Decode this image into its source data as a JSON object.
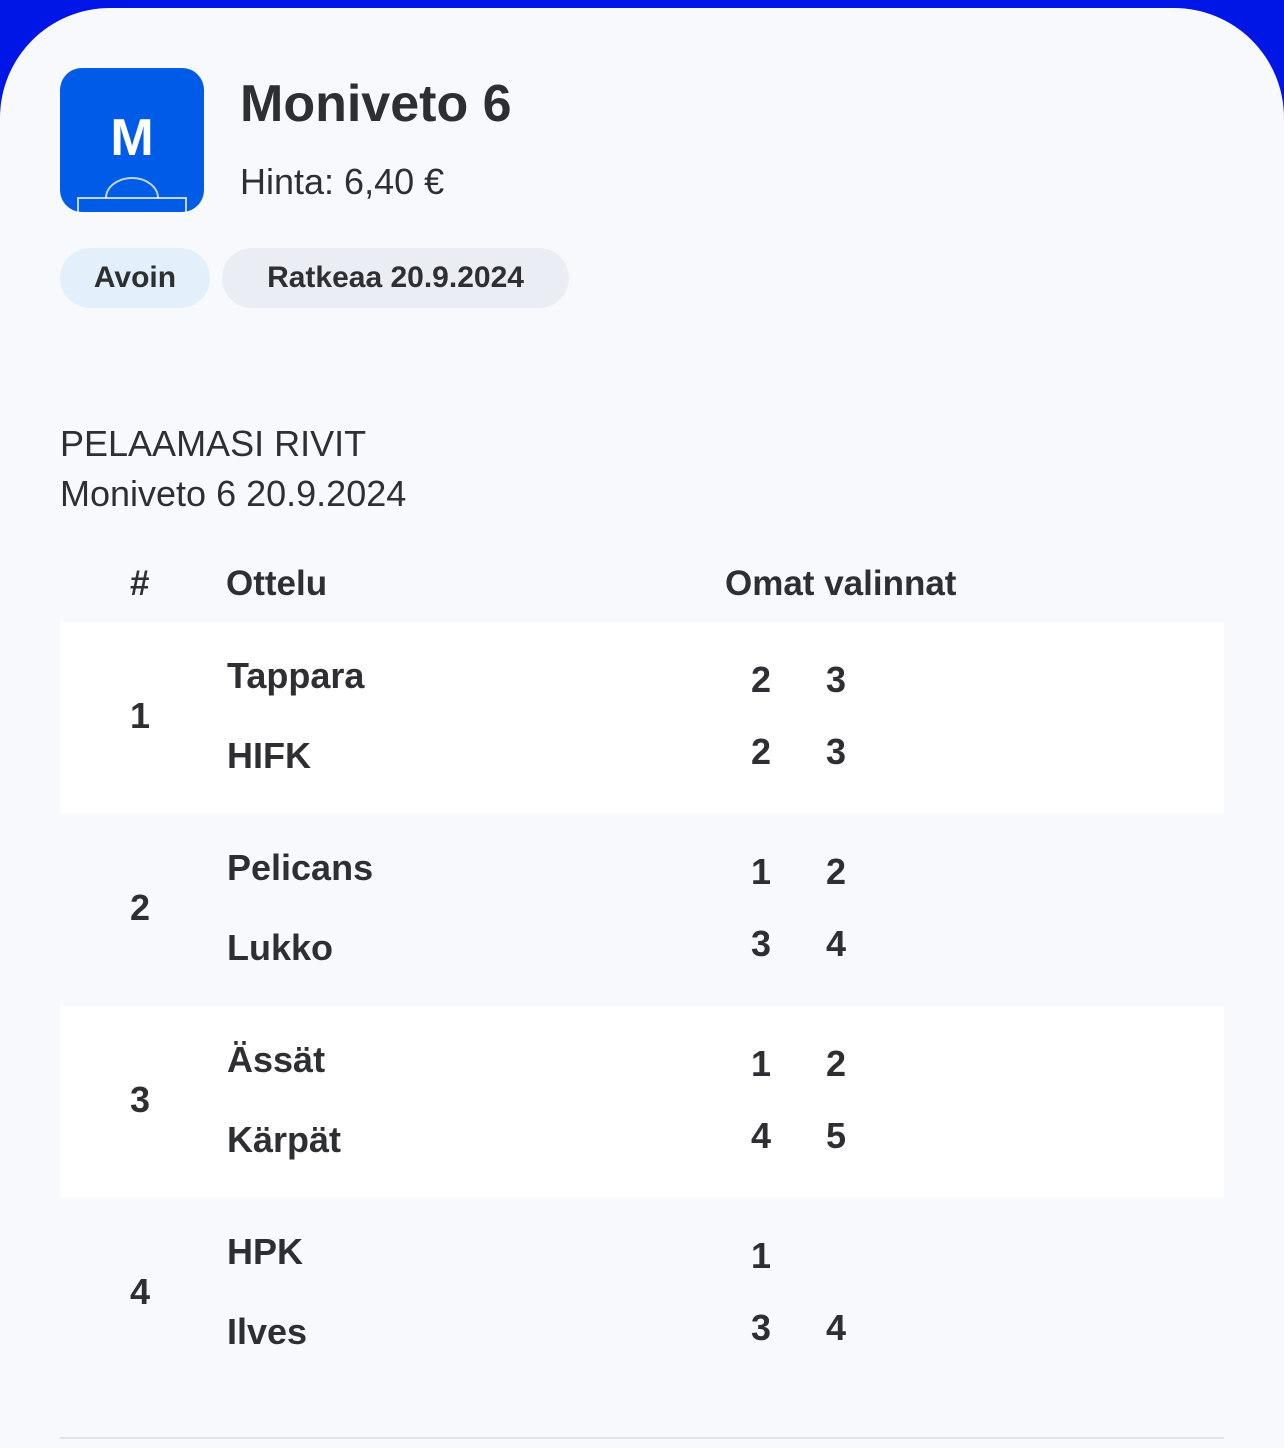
{
  "header": {
    "logo_letter": "M",
    "title": "Moniveto 6",
    "price": "Hinta: 6,40 €"
  },
  "chips": {
    "status": "Avoin",
    "resolves": "Ratkeaa 20.9.2024"
  },
  "section": {
    "heading": "PELAAMASI RIVIT",
    "subheading": "Moniveto 6 20.9.2024"
  },
  "table": {
    "columns": [
      "#",
      "Ottelu",
      "Omat valinnat"
    ],
    "rows": [
      {
        "num": "1",
        "home": "Tappara",
        "away": "HIFK",
        "home_picks": [
          "2",
          "3"
        ],
        "away_picks": [
          "2",
          "3"
        ]
      },
      {
        "num": "2",
        "home": "Pelicans",
        "away": "Lukko",
        "home_picks": [
          "1",
          "2"
        ],
        "away_picks": [
          "3",
          "4"
        ]
      },
      {
        "num": "3",
        "home": "Ässät",
        "away": "Kärpät",
        "home_picks": [
          "1",
          "2"
        ],
        "away_picks": [
          "4",
          "5"
        ]
      },
      {
        "num": "4",
        "home": "HPK",
        "away": "Ilves",
        "home_picks": [
          "1"
        ],
        "away_picks": [
          "3",
          "4"
        ]
      }
    ]
  },
  "colors": {
    "brand_blue": "#005be6",
    "top_band": "#0016e6",
    "page_bg": "#f7f9fc",
    "status_chip": "#e3f0fb",
    "date_chip": "#eaedf3"
  },
  "icons": {
    "logo": "moniveto-field-logo-icon"
  }
}
